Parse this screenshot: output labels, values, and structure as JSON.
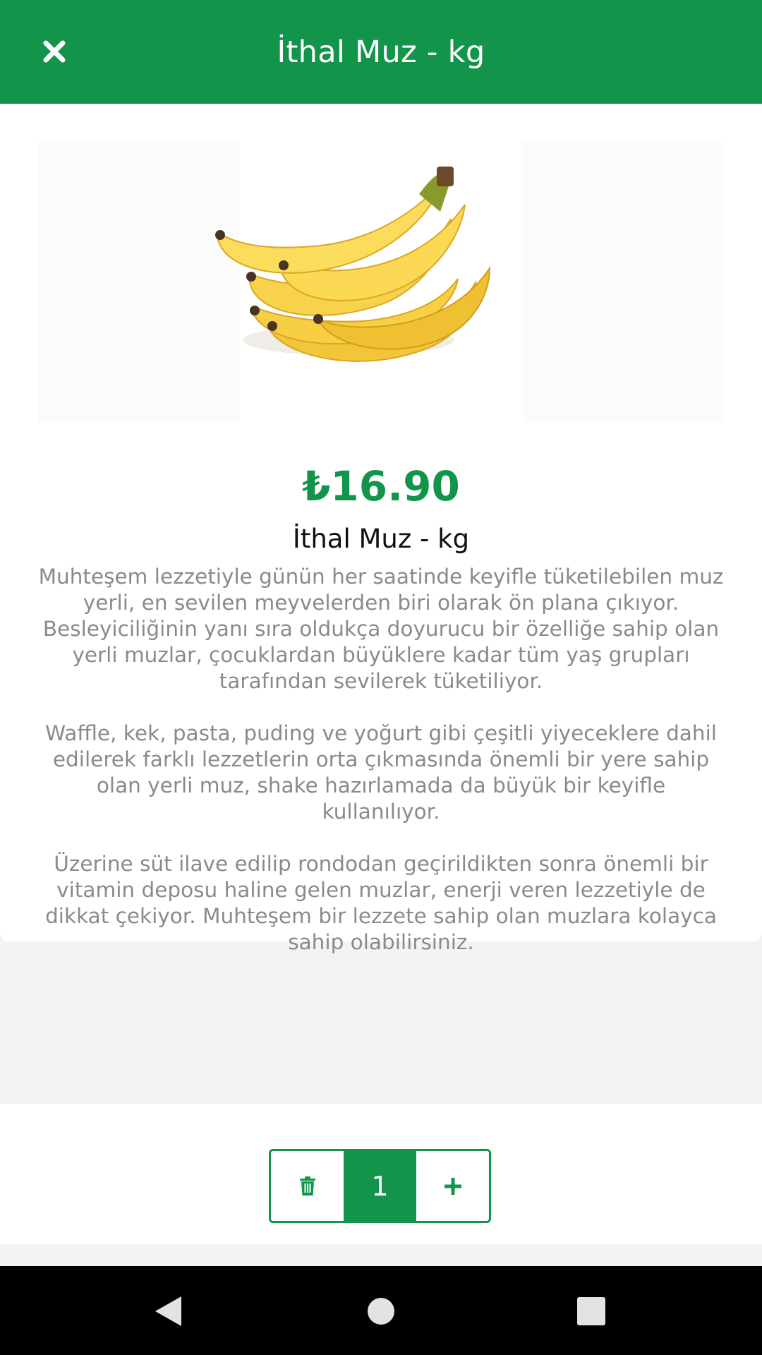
{
  "header": {
    "title": "İthal Muz - kg",
    "close_icon": "close-icon"
  },
  "product": {
    "image_icon": "banana-bunch-image",
    "price": "₺16.90",
    "name": "İthal Muz - kg",
    "description": [
      "Muhteşem lezzetiyle günün her saatinde keyifle tüketilebilen muz yerli, en sevilen meyvelerden biri olarak ön plana çıkıyor. Besleyiciliğinin yanı sıra oldukça doyurucu bir özelliğe sahip olan yerli muzlar, çocuklardan büyüklere kadar tüm yaş grupları tarafından sevilerek tüketiliyor.",
      "Waffle, kek, pasta, puding ve yoğurt gibi çeşitli yiyeceklere dahil edilerek farklı lezzetlerin orta çıkmasında önemli bir yere sahip olan yerli muz, shake hazırlamada da büyük bir keyifle kullanılıyor.",
      "Üzerine süt ilave edilip rondodan geçirildikten sonra önemli bir vitamin deposu haline gelen muzlar, enerji veren lezzetiyle de dikkat çekiyor. Muhteşem bir lezzete sahip olan muzlara kolayca sahip olabilirsiniz."
    ]
  },
  "cart_stepper": {
    "quantity": "1",
    "delete_icon": "trash-icon",
    "add_icon": "plus-icon"
  },
  "system_nav": {
    "back_icon": "back-triangle-icon",
    "home_icon": "home-circle-icon",
    "recents_icon": "recents-square-icon"
  },
  "colors": {
    "brand_green": "#12954a",
    "description_gray": "#8a8a8a"
  }
}
